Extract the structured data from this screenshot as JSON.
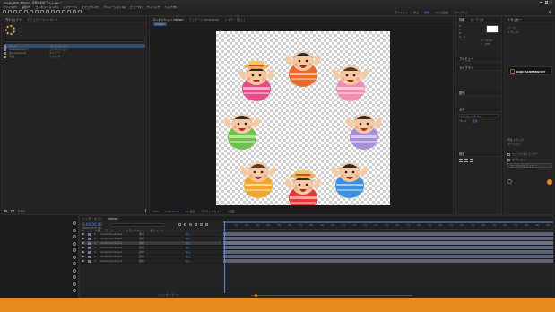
{
  "titlebar": {
    "app_title": "Adobe After Effects - 定時性的反アニメ.aep *"
  },
  "menubar": {
    "items": [
      "ファイル(F)",
      "編集(E)",
      "コンポジション(C)",
      "レイヤー(L)",
      "エフェクト(T)",
      "アニメーション(A)",
      "ビュー(V)",
      "ウィンドウ",
      "ヘルプ(H)"
    ]
  },
  "workspaces": [
    "デフォルト",
    "学ぶ",
    "標準",
    "小さな画面",
    "ライブラリ"
  ],
  "project": {
    "tabs": [
      "プロジェクト",
      "エフェクトコントロール"
    ],
    "items": [
      {
        "name": "imori",
        "type": "コンポジション"
      },
      {
        "name": "Kuwawaleopパ",
        "type": "コンポジション"
      },
      {
        "name": "Kambrokoob",
        "type": "ムービー"
      },
      {
        "name": "平面",
        "type": "フォルダー"
      }
    ],
    "bpc": "8 bpc"
  },
  "comp_panel": {
    "tabs": [
      "コンポジション mimori",
      "フッテージ Kamnenaji",
      "レイヤー (なし)"
    ],
    "subtab": "mimori",
    "footer": {
      "zoom": "25%",
      "timecode": "0;00;00;00",
      "quality": "1/4 画質",
      "camera": "アクティブカメラ",
      "views": "1画面"
    }
  },
  "info_panel": {
    "tabs": [
      "情報",
      "オーディオ"
    ],
    "values": [
      "R :",
      "G :",
      "B :",
      "A : 0",
      "X : 1120",
      "Y : 296"
    ],
    "preview_title": "プレビュー",
    "library_title": "ライブラリ",
    "brand": "DOJO SCREENSHOT",
    "align_title": "整列",
    "char_title": "文字",
    "font": "小塚ゴシック Pro",
    "size": "78 px",
    "leading": "自動",
    "para_title": "段落"
  },
  "right_panel": {
    "title": "トラッカー",
    "fields": [
      "ソース:",
      "トラック:",
      "現在トラック",
      "モーション"
    ],
    "button_label": "ワープスタビライザー",
    "checks": [
      "ワープスタビライザー",
      "オプション"
    ]
  },
  "timeline": {
    "tabs": [
      "レンダーキュー",
      "mimori"
    ],
    "timecode": "0;00;00;00",
    "fps": "00000 (29.97 fps)",
    "columns": [
      "#",
      "ソース名",
      "モード",
      "T",
      "トラックマット",
      "親とリンク"
    ],
    "layers": [
      {
        "num": "1",
        "name": "Kambrokoob.psd",
        "mode": "通常",
        "parent": "なし",
        "selected": false
      },
      {
        "num": "2",
        "name": "Kambrokoob.psd",
        "mode": "通常",
        "parent": "なし",
        "selected": false
      },
      {
        "num": "3",
        "name": "Kambrokoob.psd",
        "mode": "通常",
        "parent": "なし",
        "selected": true
      },
      {
        "num": "4",
        "name": "Kambrokoob.psd",
        "mode": "通常",
        "parent": "なし",
        "selected": false
      },
      {
        "num": "5",
        "name": "Kambrokoob.psd",
        "mode": "通常",
        "parent": "なし",
        "selected": false
      },
      {
        "num": "6",
        "name": "Kambrokoob.psd",
        "mode": "通常",
        "parent": "なし",
        "selected": false
      },
      {
        "num": "7",
        "name": "Kambrokoob.psd",
        "mode": "通常",
        "parent": "なし",
        "selected": false
      }
    ],
    "ruler": [
      "0s",
      "01s",
      "02s",
      "03s",
      "04s",
      "05s",
      "06s",
      "07s",
      "08s",
      "09s",
      "10s",
      "11s",
      "12s",
      "13s",
      "14s",
      "15s",
      "16s",
      "17s",
      "18s",
      "19s",
      "20s",
      "21s",
      "22s",
      "23s",
      "24s",
      "25s",
      "26s",
      "27s",
      "28s",
      "29s",
      "30s"
    ],
    "footer_label": "スイッチ / モード"
  },
  "colors": {
    "accent_blue": "#4b8fe8",
    "accent_orange": "#e8891f",
    "track_lavender": "#5d6378",
    "track_selected": "#6c7387"
  },
  "characters": [
    {
      "id": "top",
      "hat": false,
      "hair": "#2a2a2a",
      "body": "#e86b2b"
    },
    {
      "id": "top-left",
      "hat": true,
      "hair": "#2a2a2a",
      "body": "#e54d8a"
    },
    {
      "id": "top-right",
      "hat": false,
      "hair": "#5a3a1e",
      "body": "#f28cb0"
    },
    {
      "id": "left",
      "hat": false,
      "hair": "#2a2a2a",
      "body": "#6dc24b"
    },
    {
      "id": "right",
      "hat": false,
      "hair": "#2a2a2a",
      "body": "#a68fd8"
    },
    {
      "id": "bottom-left",
      "hat": false,
      "hair": "#5a3a1e",
      "body": "#f4a62a"
    },
    {
      "id": "bottom",
      "hat": true,
      "hair": "#2a2a2a",
      "body": "#e23a3a"
    },
    {
      "id": "bottom-right",
      "hat": false,
      "hair": "#2a2a2a",
      "body": "#3a8fe0"
    }
  ]
}
